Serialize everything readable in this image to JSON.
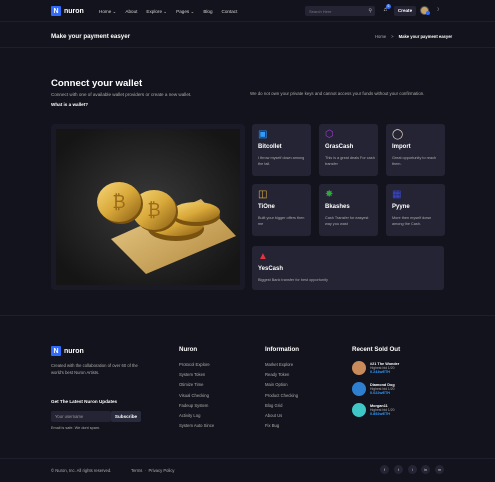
{
  "header": {
    "logo_letter": "N",
    "logo_text": "nuron",
    "nav": [
      "Home",
      "About",
      "Explore",
      "Pages",
      "Blog",
      "Contact"
    ],
    "search_placeholder": "Search Here",
    "notification_count": "6",
    "create_label": "Create"
  },
  "titlebar": {
    "title": "Make your payment easyer",
    "crumb_home": "Home",
    "crumb_current": "Make your payment easyer"
  },
  "connect": {
    "title": "Connect your wallet",
    "subtitle": "Connect with one of available wallet providers or create a new wallet.",
    "what": "What is a wallet?",
    "note": "We do not own your private keys and cannot access your funds without your confirmation."
  },
  "wallets": [
    {
      "name": "Bitcollet",
      "desc": "I throw myself down among the tall.",
      "icon": "wallet-icon",
      "color": "#2f9bff"
    },
    {
      "name": "GrasCash",
      "desc": "This is a great deals For cash transfer",
      "icon": "cube-icon",
      "color": "#a13bd8"
    },
    {
      "name": "Import",
      "desc": "Great opportunity to reach them.",
      "icon": "award-icon",
      "color": "#f0e1c0"
    },
    {
      "name": "TiOne",
      "desc": "Built your bigger offers then me",
      "icon": "briefcase-icon",
      "color": "#e4b23d"
    },
    {
      "name": "Bkashes",
      "desc": "Cash Transfer for easyest way you wast",
      "icon": "share-icon",
      "color": "#2fa83b"
    },
    {
      "name": "Pyyne",
      "desc": "More then myself down among the Cash.",
      "icon": "database-icon",
      "color": "#3a47d8"
    },
    {
      "name": "YesCash",
      "desc": "Biggest Bank transfer for best opportunity",
      "icon": "bank-icon",
      "color": "#e2343f"
    }
  ],
  "footer": {
    "about": "Created with the collaboration of over 60 of the world's best Nuron Artists.",
    "updates_title": "Get The Latest Nuron Updates",
    "email_placeholder": "Your username",
    "subscribe_label": "Subscribe",
    "email_note": "Email is safe. We dont spam.",
    "col1_title": "Nuron",
    "col1_links": [
      "Protocol Explore",
      "System Token",
      "Otimize Time",
      "Visual Checking",
      "Fadeup System",
      "Activity Log",
      "System Auto Since"
    ],
    "col2_title": "Information",
    "col2_links": [
      "Market Explore",
      "Ready Token",
      "Main Option",
      "Product Checking",
      "Blog Grid",
      "About Us",
      "Fix Bug"
    ],
    "col3_title": "Recent Sold Out",
    "sold": [
      {
        "name": "#21 The Wonder",
        "bid": "Highest bid 1/20",
        "price": "0.244wETH",
        "color": "#c98b5a"
      },
      {
        "name": "Diamond Dog",
        "bid": "Highest bid 1/20",
        "price": "0.022wETH",
        "color": "#2f7fd0"
      },
      {
        "name": "Morgan11",
        "bid": "Highest bid 1/20",
        "price": "0.892wETH",
        "color": "#3fc7c7"
      }
    ],
    "copyright": "© Nuron, Inc. All rights reserved.",
    "terms": "Terms",
    "privacy": "Privacy Policy",
    "social": [
      "f",
      "t",
      "i",
      "in",
      "m"
    ]
  }
}
